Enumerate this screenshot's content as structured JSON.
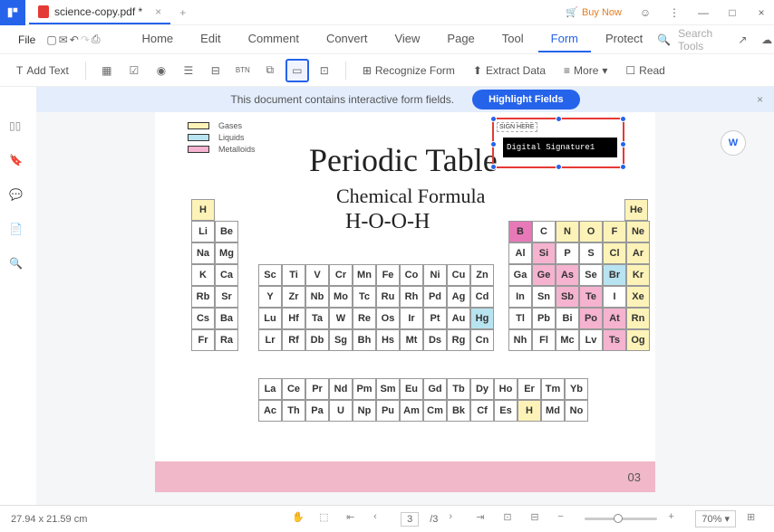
{
  "titlebar": {
    "filename": "science-copy.pdf *",
    "buy": "Buy Now"
  },
  "menu": {
    "file": "File",
    "items": [
      "Home",
      "Edit",
      "Comment",
      "Convert",
      "View",
      "Page",
      "Tool",
      "Form",
      "Protect"
    ],
    "active": 7,
    "search": "Search Tools"
  },
  "toolbar": {
    "addtext": "Add Text",
    "recognize": "Recognize Form",
    "extract": "Extract Data",
    "more": "More",
    "read": "Read"
  },
  "banner": {
    "msg": "This document contains interactive form fields.",
    "btn": "Highlight Fields"
  },
  "doc": {
    "legend": [
      {
        "c": "#fdf3b8",
        "l": "Gases"
      },
      {
        "c": "#b8e3f0",
        "l": "Liquids"
      },
      {
        "c": "#f5b3d0",
        "l": "Metalloids"
      }
    ],
    "title": "Periodic Table",
    "subtitle": "Chemical Formula",
    "formula": "H-O-O-H",
    "signhere": "SIGN HERE",
    "sigfield": "Digital Signature1",
    "page_num": "03"
  },
  "elements": {
    "H": "H",
    "He": "He",
    "left": [
      [
        "Li",
        "Be"
      ],
      [
        "Na",
        "Mg"
      ],
      [
        "K",
        "Ca"
      ],
      [
        "Rb",
        "Sr"
      ],
      [
        "Cs",
        "Ba"
      ],
      [
        "Fr",
        "Ra"
      ]
    ],
    "mid": [
      [
        "Sc",
        "Ti",
        "V",
        "Cr",
        "Mn",
        "Fe",
        "Co",
        "Ni",
        "Cu",
        "Zn"
      ],
      [
        "Y",
        "Zr",
        "Nb",
        "Mo",
        "Tc",
        "Ru",
        "Rh",
        "Pd",
        "Ag",
        "Cd"
      ],
      [
        "Lu",
        "Hf",
        "Ta",
        "W",
        "Re",
        "Os",
        "Ir",
        "Pt",
        "Au",
        "Hg"
      ],
      [
        "Lr",
        "Rf",
        "Db",
        "Sg",
        "Bh",
        "Hs",
        "Mt",
        "Ds",
        "Rg",
        "Cn"
      ]
    ],
    "right": [
      [
        "B",
        "C",
        "N",
        "O",
        "F",
        "Ne"
      ],
      [
        "Al",
        "Si",
        "P",
        "S",
        "Cl",
        "Ar"
      ],
      [
        "Ga",
        "Ge",
        "As",
        "Se",
        "Br",
        "Kr"
      ],
      [
        "In",
        "Sn",
        "Sb",
        "Te",
        "I",
        "Xe"
      ],
      [
        "Tl",
        "Pb",
        "Bi",
        "Po",
        "At",
        "Rn"
      ],
      [
        "Nh",
        "Fl",
        "Mc",
        "Lv",
        "Ts",
        "Og"
      ]
    ],
    "lan": [
      [
        "La",
        "Ce",
        "Pr",
        "Nd",
        "Pm",
        "Sm",
        "Eu",
        "Gd",
        "Tb",
        "Dy",
        "Ho",
        "Er",
        "Tm",
        "Yb"
      ],
      [
        "Ac",
        "Th",
        "Pa",
        "U",
        "Np",
        "Pu",
        "Am",
        "Cm",
        "Bk",
        "Cf",
        "Es",
        "H",
        "Md",
        "No"
      ]
    ],
    "colors": {
      "H": "yellow",
      "He": "yellow",
      "O": "yellow",
      "F": "yellow",
      "Ne": "yellow",
      "Cl": "yellow",
      "Ar": "yellow",
      "Kr": "yellow",
      "Xe": "yellow",
      "Rn": "yellow",
      "Og": "yellow",
      "N": "yellow",
      "Br": "blue",
      "Hg": "blue",
      "B": "magenta",
      "Si": "pink",
      "Ge": "pink",
      "As": "pink",
      "Sb": "pink",
      "Te": "pink",
      "Po": "pink",
      "At": "pink",
      "Ts": "pink"
    }
  },
  "status": {
    "dims": "27.94 x 21.59 cm",
    "page": "3",
    "total": "/3",
    "zoom": "70%"
  }
}
